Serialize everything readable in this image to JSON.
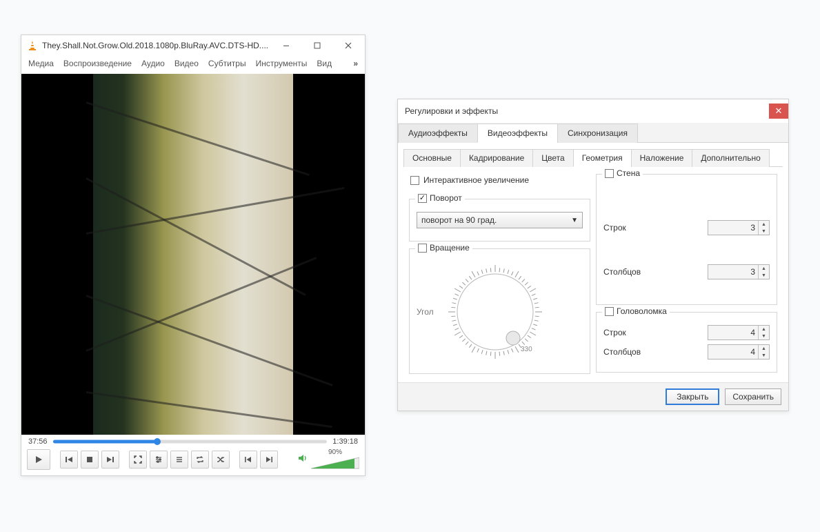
{
  "vlc": {
    "title": "They.Shall.Not.Grow.Old.2018.1080p.BluRay.AVC.DTS-HD....",
    "menus": [
      "Медиа",
      "Воспроизведение",
      "Аудио",
      "Видео",
      "Субтитры",
      "Инструменты",
      "Вид"
    ],
    "time_elapsed": "37:56",
    "time_total": "1:39:18",
    "seek_percent": 38,
    "volume_percent": "90%",
    "volume_fill": 90,
    "icons": {
      "minimize": "minimize-icon",
      "maximize": "maximize-icon",
      "close": "close-icon",
      "more": "»"
    }
  },
  "fx": {
    "title": "Регулировки и эффекты",
    "tabs": [
      "Аудиоэффекты",
      "Видеоэффекты",
      "Синхронизация"
    ],
    "active_tab": 1,
    "subtabs": [
      "Основные",
      "Кадрирование",
      "Цвета",
      "Геометрия",
      "Наложение",
      "Дополнительно"
    ],
    "active_subtab": 3,
    "geometry": {
      "interactive_zoom": {
        "label": "Интерактивное увеличение",
        "checked": false
      },
      "rotate": {
        "label": "Поворот",
        "checked": true,
        "selected": "поворот на 90 град."
      },
      "rotation": {
        "label": "Вращение",
        "checked": false,
        "angle_label": "Угол",
        "angle_tick_label": "330"
      },
      "wall": {
        "label": "Стена",
        "checked": false,
        "rows_label": "Строк",
        "rows_value": "3",
        "cols_label": "Столбцов",
        "cols_value": "3"
      },
      "puzzle": {
        "label": "Головоломка",
        "checked": false,
        "rows_label": "Строк",
        "rows_value": "4",
        "cols_label": "Столбцов",
        "cols_value": "4"
      }
    },
    "buttons": {
      "close": "Закрыть",
      "save": "Сохранить"
    }
  }
}
